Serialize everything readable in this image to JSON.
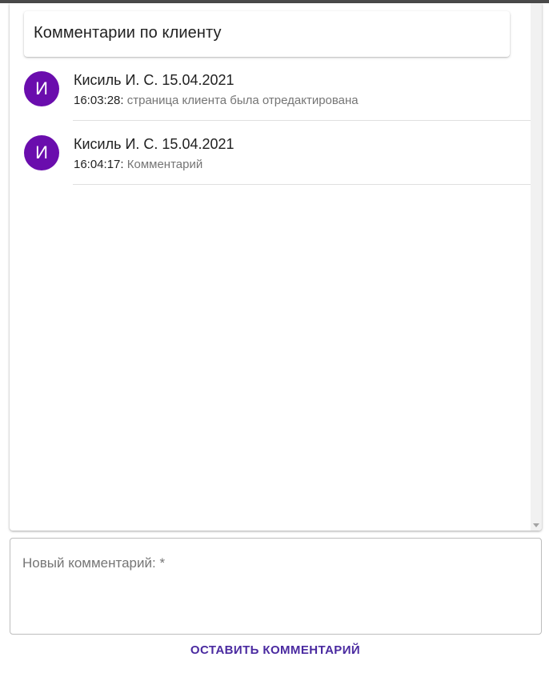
{
  "panel": {
    "title": "Комментарии по клиенту"
  },
  "comments": [
    {
      "avatar_letter": "И",
      "author": "Кисиль И. С. 15.04.2021",
      "time": "16:03:28:",
      "text": "страница клиента была отредактирована"
    },
    {
      "avatar_letter": "И",
      "author": "Кисиль И. С. 15.04.2021",
      "time": "16:04:17:",
      "text": "Комментарий"
    }
  ],
  "new_comment": {
    "label": "Новый комментарий: *",
    "value": ""
  },
  "actions": {
    "submit_label": "Оставить комментарий"
  },
  "colors": {
    "avatar": "#6a0dad",
    "accent": "#4a2aa0"
  }
}
